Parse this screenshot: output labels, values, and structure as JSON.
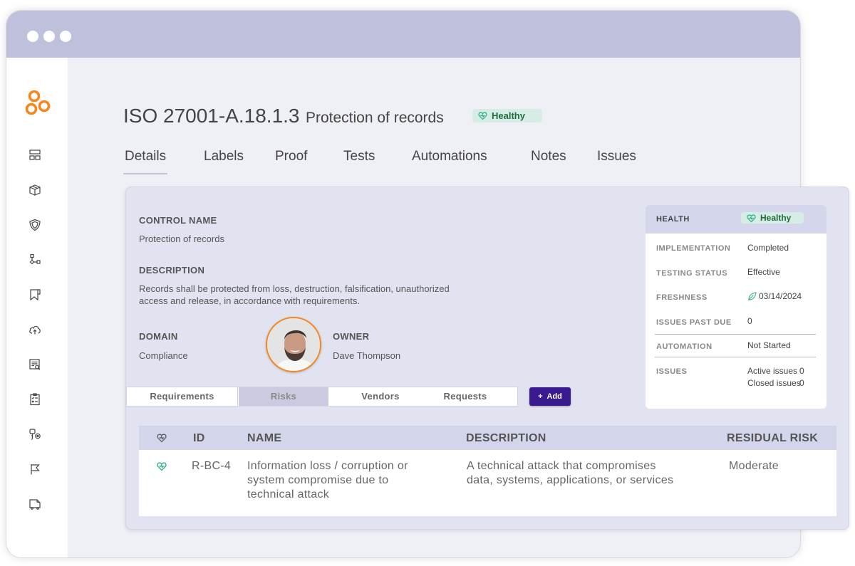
{
  "window": {
    "controls": [
      "dot",
      "dot",
      "dot"
    ]
  },
  "sidebar": {
    "logo": "orange-rings-logo",
    "items": [
      {
        "icon": "dashboard-icon"
      },
      {
        "icon": "box-icon"
      },
      {
        "icon": "shield-icon"
      },
      {
        "icon": "workflow-icon"
      },
      {
        "icon": "bookmark-icon"
      },
      {
        "icon": "cloud-upload-icon"
      },
      {
        "icon": "document-search-icon"
      },
      {
        "icon": "clipboard-checklist-icon"
      },
      {
        "icon": "key-settings-icon"
      },
      {
        "icon": "flag-icon"
      },
      {
        "icon": "vehicle-icon"
      }
    ]
  },
  "header": {
    "code": "ISO 27001-A.18.1.3",
    "name": "Protection of records",
    "status_badge": "Healthy"
  },
  "tabs": [
    {
      "label": "Details",
      "active": true
    },
    {
      "label": "Labels"
    },
    {
      "label": "Proof"
    },
    {
      "label": "Tests"
    },
    {
      "label": "Automations"
    },
    {
      "label": "Notes"
    },
    {
      "label": "Issues"
    }
  ],
  "details": {
    "control_name_label": "CONTROL NAME",
    "control_name": "Protection of records",
    "description_label": "DESCRIPTION",
    "description": "Records shall be protected from loss, destruction, falsification, unauthorized access and release, in accordance with requirements.",
    "domain_label": "DOMAIN",
    "domain": "Compliance",
    "owner_label": "OWNER",
    "owner": "Dave Thompson"
  },
  "subtabs": [
    {
      "label": "Requirements"
    },
    {
      "label": "Risks",
      "active": true
    },
    {
      "label": "Vendors"
    },
    {
      "label": "Requests"
    }
  ],
  "add_button": {
    "icon": "+",
    "label": "Add"
  },
  "health_card": {
    "health_label": "HEALTH",
    "health_value": "Healthy",
    "rows": [
      {
        "label": "IMPLEMENTATION",
        "value": "Completed"
      },
      {
        "label": "TESTING STATUS",
        "value": "Effective"
      },
      {
        "label": "FRESHNESS",
        "value": "03/14/2024"
      },
      {
        "label": "ISSUES PAST DUE",
        "value": "0"
      },
      {
        "label": "AUTOMATION",
        "value": "Not Started"
      },
      {
        "label": "ISSUES",
        "active_label": "Active issues",
        "active_value": "0",
        "closed_label": "Closed issues",
        "closed_value": "0"
      }
    ]
  },
  "risk_table": {
    "columns": [
      "ID",
      "NAME",
      "DESCRIPTION",
      "RESIDUAL RISK"
    ],
    "rows": [
      {
        "id": "R-BC-4",
        "name_lines": [
          "Information loss / corruption or",
          "system compromise due to",
          "technical attack"
        ],
        "description_lines": [
          "A technical attack that compromises",
          "data, systems, applications, or services"
        ],
        "residual_risk": "Moderate"
      }
    ]
  },
  "colors": {
    "accent": "#3a1a8f",
    "brand_orange": "#f7861e",
    "healthy_bg": "#d6ede6",
    "healthy_text": "#1f6b3a",
    "healthy_icon": "#2db08a",
    "titlebar": "#bfc0dc"
  }
}
